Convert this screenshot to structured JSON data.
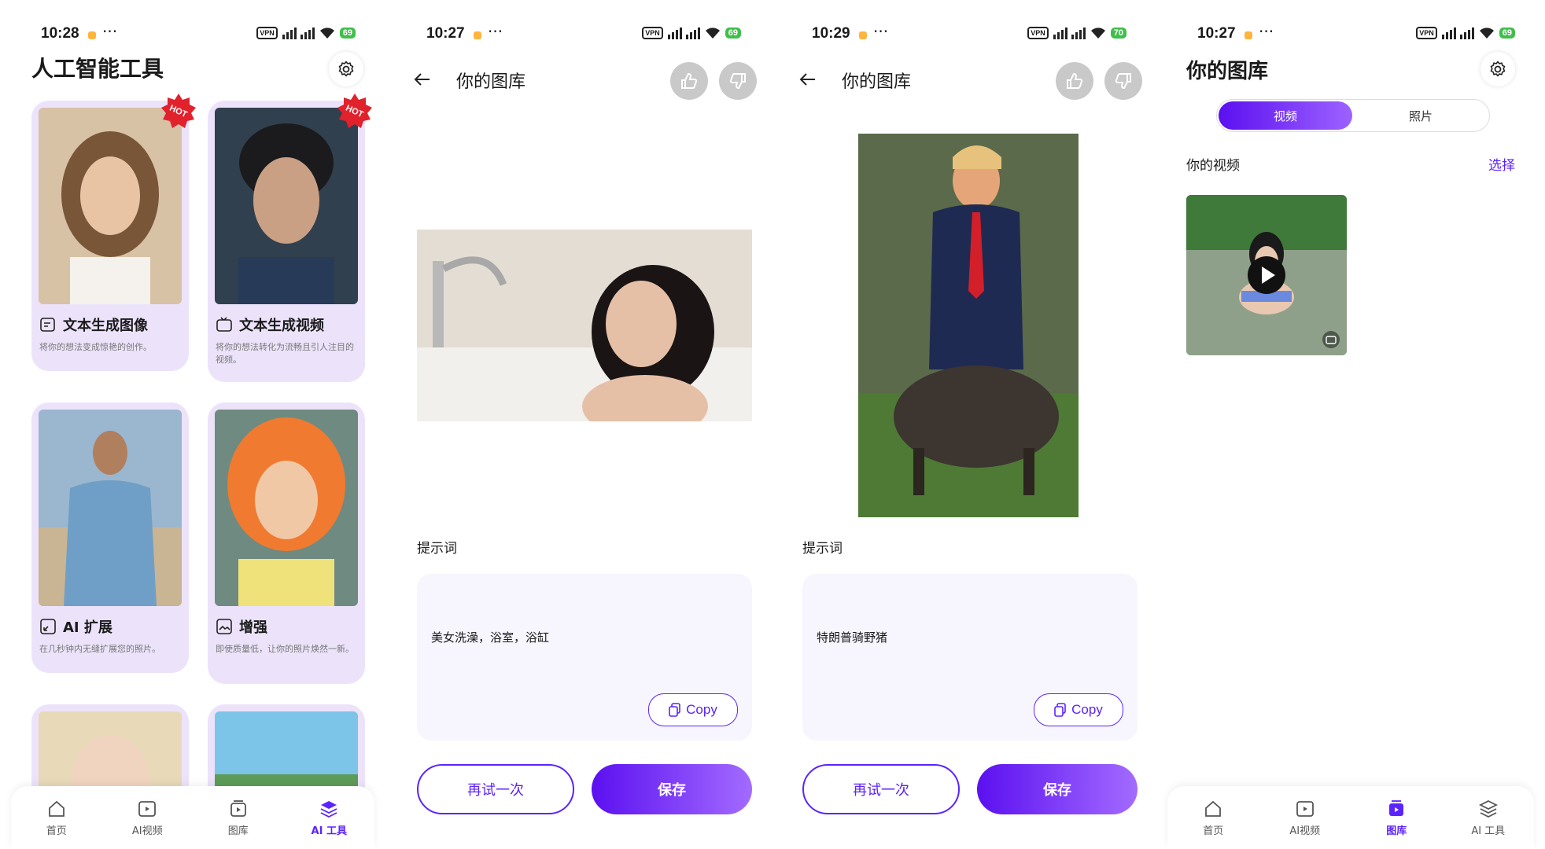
{
  "colors": {
    "accent": "#5b23ff",
    "card_bg": "#ece3fb",
    "hot": "#e1222d",
    "battery": "#3fbf4a"
  },
  "screen1": {
    "status": {
      "time": "10:28",
      "battery": "69"
    },
    "title": "人工智能工具",
    "cards": [
      {
        "title": "文本生成图像",
        "desc": "将你的想法变成惊艳的创作。",
        "badge": "HOT",
        "icon": "text-to-image-icon"
      },
      {
        "title": "文本生成视频",
        "desc": "将你的想法转化为流畅且引人注目的视频。",
        "badge": "HOT",
        "icon": "text-to-video-icon"
      },
      {
        "title": "AI 扩展",
        "desc": "在几秒钟内无缝扩展您的照片。",
        "icon": "expand-icon"
      },
      {
        "title": "增强",
        "desc": "即使质量低，让你的照片焕然一新。",
        "icon": "hd-enhance-icon"
      }
    ],
    "tabs": [
      {
        "label": "首页",
        "icon": "home-icon"
      },
      {
        "label": "AI视频",
        "icon": "video-icon"
      },
      {
        "label": "图库",
        "icon": "gallery-icon"
      },
      {
        "label": "AI 工具",
        "icon": "layers-icon",
        "active": true
      }
    ]
  },
  "screen2": {
    "status": {
      "time": "10:27",
      "battery": "69"
    },
    "title": "你的图库",
    "prompt_label": "提示词",
    "prompt_text": "美女洗澡，浴室，浴缸",
    "copy_label": "Copy",
    "retry_label": "再试一次",
    "save_label": "保存"
  },
  "screen3": {
    "status": {
      "time": "10:29",
      "battery": "70"
    },
    "title": "你的图库",
    "prompt_label": "提示词",
    "prompt_text": "特朗普骑野猪",
    "copy_label": "Copy",
    "retry_label": "再试一次",
    "save_label": "保存"
  },
  "screen4": {
    "status": {
      "time": "10:27",
      "battery": "69"
    },
    "title": "你的图库",
    "segments": [
      "视频",
      "照片"
    ],
    "section_label": "你的视频",
    "select_label": "选择",
    "tabs": [
      {
        "label": "首页",
        "icon": "home-icon"
      },
      {
        "label": "AI视频",
        "icon": "video-icon"
      },
      {
        "label": "图库",
        "icon": "gallery-icon",
        "active": true
      },
      {
        "label": "AI 工具",
        "icon": "layers-icon"
      }
    ]
  }
}
